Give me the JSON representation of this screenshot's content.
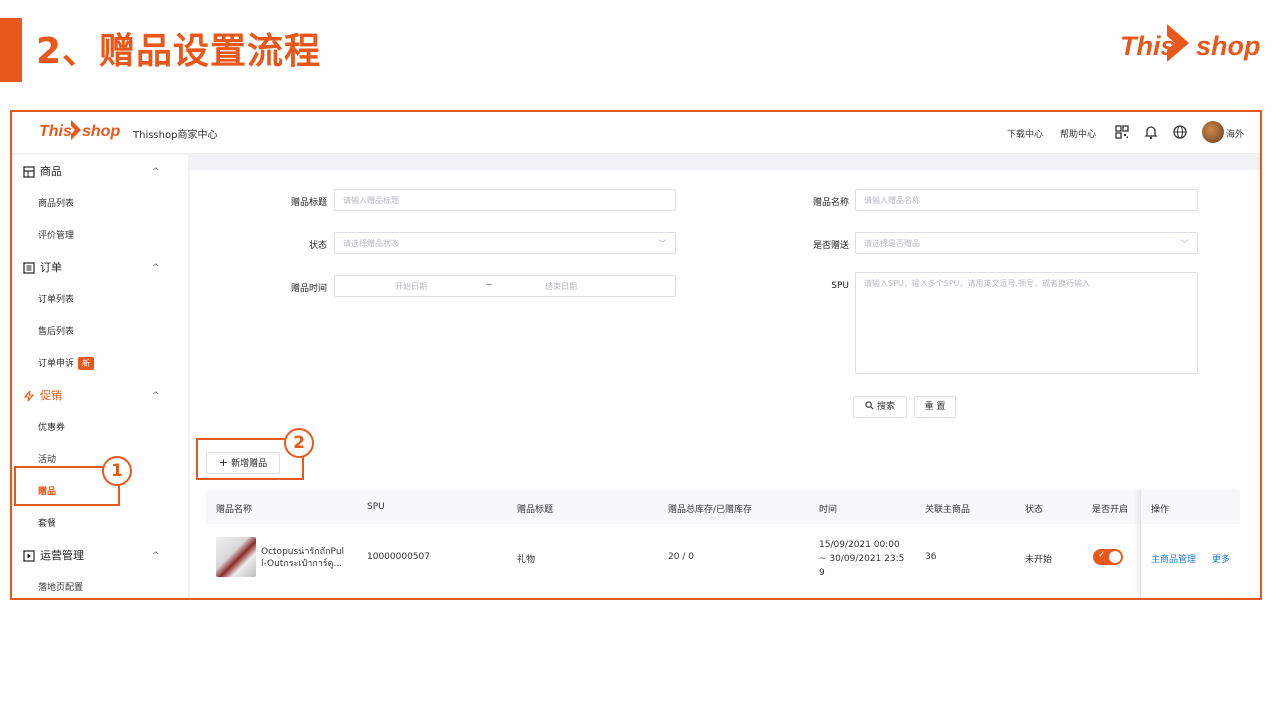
{
  "slide": {
    "title": "2、赠品设置流程",
    "brand_this": "This",
    "brand_shop": "shop"
  },
  "colors": {
    "accent": "#e8581a",
    "link": "#1e7bd6"
  },
  "topbar": {
    "logo_this": "This",
    "logo_shop": "shop",
    "merchant_center": "Thisshop商家中心",
    "download_center": "下载中心",
    "help_center": "帮助中心",
    "region": "海外",
    "icons": [
      "qr-code-icon",
      "bell-icon",
      "globe-icon"
    ]
  },
  "sidebar": {
    "groups": [
      {
        "label": "商品",
        "icon": "shop-icon",
        "items": [
          "商品列表",
          "评价管理"
        ]
      },
      {
        "label": "订单",
        "icon": "order-icon",
        "items": [
          "订单列表",
          "售后列表",
          "订单申诉"
        ]
      },
      {
        "label": "促销",
        "icon": "flash-icon",
        "items": [
          "优惠券",
          "活动",
          "赠品",
          "套餐"
        ]
      },
      {
        "label": "运营管理",
        "icon": "ops-icon",
        "items": [
          "落地页配置"
        ]
      }
    ],
    "new_badge": "新",
    "active_item": "赠品"
  },
  "filters": {
    "gift_title_label": "赠品标题",
    "gift_title_placeholder": "请输入赠品标题",
    "gift_name_label": "赠品名称",
    "gift_name_placeholder": "请输入赠品名称",
    "status_label": "状态",
    "status_placeholder": "请选择赠品状态",
    "is_gifted_label": "是否赠送",
    "is_gifted_placeholder": "请选择是否赠品",
    "time_label": "赠品时间",
    "start_placeholder": "开始日期",
    "range_sep": "~",
    "end_placeholder": "结束日期",
    "spu_label": "SPU",
    "spu_placeholder": "请输入SPU，输入多个SPU，请用英文逗号,顿号，或者换行输入",
    "search_label": "搜索",
    "reset_label": "重 置"
  },
  "add_gift_label": "新增赠品",
  "table": {
    "headers": [
      "赠品名称",
      "SPU",
      "赠品标题",
      "赠品总库存/已赠库存",
      "时间",
      "关联主商品",
      "状态",
      "是否开启",
      "操作"
    ],
    "rows": [
      {
        "name_line1": "Octopusน่ารักถักPul",
        "name_line2": "l-Outกระเป๋าการ์ดู...",
        "spu": "10000000507",
        "title": "礼物",
        "stock": "20 / 0",
        "time_line1": "15/09/2021 00:00",
        "time_line2": "~ 30/09/2021 23:5",
        "time_line3": "9",
        "linked": "36",
        "status": "未开始",
        "enabled": true,
        "op_main": "主商品管理",
        "op_more": "更多"
      }
    ]
  },
  "callouts": [
    "1",
    "2"
  ]
}
